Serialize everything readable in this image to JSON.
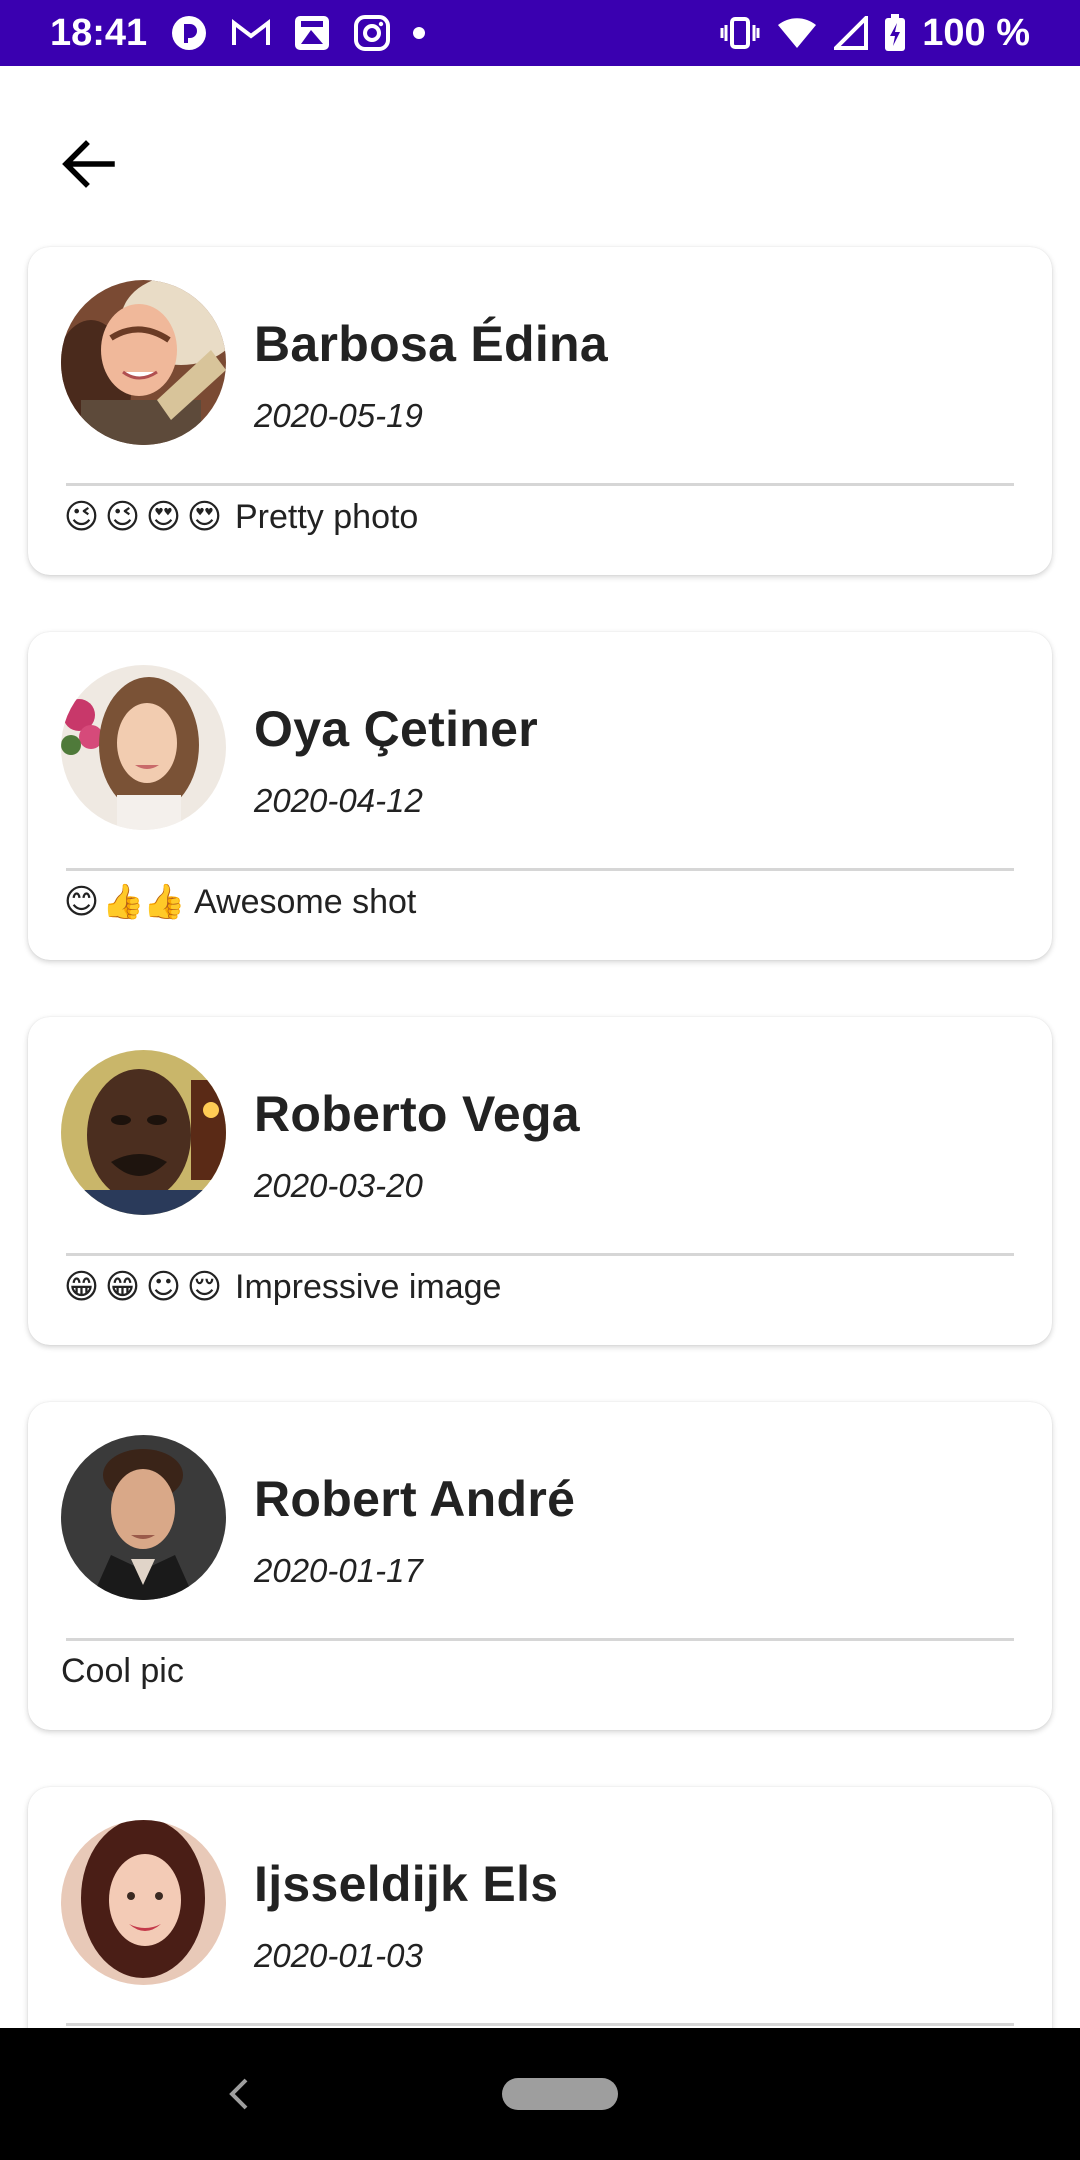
{
  "status_bar": {
    "time": "18:41",
    "battery": "100 %",
    "bg_color": "#3a00b0"
  },
  "toolbar": {
    "back_icon": "arrow-back-icon"
  },
  "comments": [
    {
      "name": "Barbosa Édina",
      "date": "2020-05-19",
      "emojis": [
        "😉",
        "😉",
        "😍",
        "😍"
      ],
      "text": "Pretty photo"
    },
    {
      "name": "Oya Çetiner",
      "date": "2020-04-12",
      "emojis": [
        "😊",
        "👍",
        "👍"
      ],
      "text": "Awesome shot"
    },
    {
      "name": "Roberto Vega",
      "date": "2020-03-20",
      "emojis": [
        "😁",
        "😁",
        "☺",
        "😌"
      ],
      "text": "Impressive image"
    },
    {
      "name": "Robert André",
      "date": "2020-01-17",
      "emojis": [],
      "text": "Cool pic"
    },
    {
      "name": "Ijsseldijk Els",
      "date": "2020-01-03",
      "emojis": [],
      "text": ""
    }
  ],
  "nav_bar": {
    "back_icon": "nav-back-icon",
    "home_icon": "home-pill-icon"
  }
}
